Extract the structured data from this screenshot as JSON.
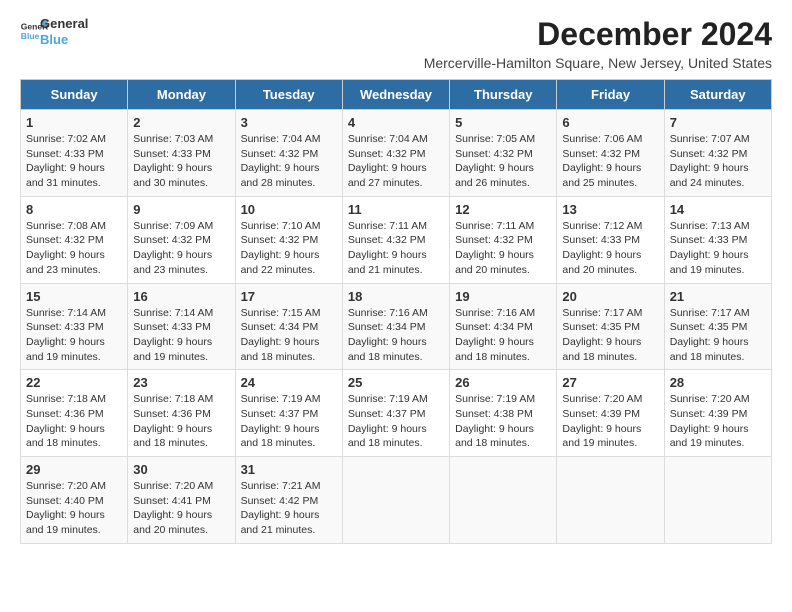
{
  "header": {
    "logo_line1": "General",
    "logo_line2": "Blue",
    "main_title": "December 2024",
    "subtitle": "Mercerville-Hamilton Square, New Jersey, United States"
  },
  "days_of_week": [
    "Sunday",
    "Monday",
    "Tuesday",
    "Wednesday",
    "Thursday",
    "Friday",
    "Saturday"
  ],
  "weeks": [
    [
      {
        "day": "1",
        "sunrise": "7:02 AM",
        "sunset": "4:33 PM",
        "daylight": "9 hours and 31 minutes."
      },
      {
        "day": "2",
        "sunrise": "7:03 AM",
        "sunset": "4:33 PM",
        "daylight": "9 hours and 30 minutes."
      },
      {
        "day": "3",
        "sunrise": "7:04 AM",
        "sunset": "4:32 PM",
        "daylight": "9 hours and 28 minutes."
      },
      {
        "day": "4",
        "sunrise": "7:04 AM",
        "sunset": "4:32 PM",
        "daylight": "9 hours and 27 minutes."
      },
      {
        "day": "5",
        "sunrise": "7:05 AM",
        "sunset": "4:32 PM",
        "daylight": "9 hours and 26 minutes."
      },
      {
        "day": "6",
        "sunrise": "7:06 AM",
        "sunset": "4:32 PM",
        "daylight": "9 hours and 25 minutes."
      },
      {
        "day": "7",
        "sunrise": "7:07 AM",
        "sunset": "4:32 PM",
        "daylight": "9 hours and 24 minutes."
      }
    ],
    [
      {
        "day": "8",
        "sunrise": "7:08 AM",
        "sunset": "4:32 PM",
        "daylight": "9 hours and 23 minutes."
      },
      {
        "day": "9",
        "sunrise": "7:09 AM",
        "sunset": "4:32 PM",
        "daylight": "9 hours and 23 minutes."
      },
      {
        "day": "10",
        "sunrise": "7:10 AM",
        "sunset": "4:32 PM",
        "daylight": "9 hours and 22 minutes."
      },
      {
        "day": "11",
        "sunrise": "7:11 AM",
        "sunset": "4:32 PM",
        "daylight": "9 hours and 21 minutes."
      },
      {
        "day": "12",
        "sunrise": "7:11 AM",
        "sunset": "4:32 PM",
        "daylight": "9 hours and 20 minutes."
      },
      {
        "day": "13",
        "sunrise": "7:12 AM",
        "sunset": "4:33 PM",
        "daylight": "9 hours and 20 minutes."
      },
      {
        "day": "14",
        "sunrise": "7:13 AM",
        "sunset": "4:33 PM",
        "daylight": "9 hours and 19 minutes."
      }
    ],
    [
      {
        "day": "15",
        "sunrise": "7:14 AM",
        "sunset": "4:33 PM",
        "daylight": "9 hours and 19 minutes."
      },
      {
        "day": "16",
        "sunrise": "7:14 AM",
        "sunset": "4:33 PM",
        "daylight": "9 hours and 19 minutes."
      },
      {
        "day": "17",
        "sunrise": "7:15 AM",
        "sunset": "4:34 PM",
        "daylight": "9 hours and 18 minutes."
      },
      {
        "day": "18",
        "sunrise": "7:16 AM",
        "sunset": "4:34 PM",
        "daylight": "9 hours and 18 minutes."
      },
      {
        "day": "19",
        "sunrise": "7:16 AM",
        "sunset": "4:34 PM",
        "daylight": "9 hours and 18 minutes."
      },
      {
        "day": "20",
        "sunrise": "7:17 AM",
        "sunset": "4:35 PM",
        "daylight": "9 hours and 18 minutes."
      },
      {
        "day": "21",
        "sunrise": "7:17 AM",
        "sunset": "4:35 PM",
        "daylight": "9 hours and 18 minutes."
      }
    ],
    [
      {
        "day": "22",
        "sunrise": "7:18 AM",
        "sunset": "4:36 PM",
        "daylight": "9 hours and 18 minutes."
      },
      {
        "day": "23",
        "sunrise": "7:18 AM",
        "sunset": "4:36 PM",
        "daylight": "9 hours and 18 minutes."
      },
      {
        "day": "24",
        "sunrise": "7:19 AM",
        "sunset": "4:37 PM",
        "daylight": "9 hours and 18 minutes."
      },
      {
        "day": "25",
        "sunrise": "7:19 AM",
        "sunset": "4:37 PM",
        "daylight": "9 hours and 18 minutes."
      },
      {
        "day": "26",
        "sunrise": "7:19 AM",
        "sunset": "4:38 PM",
        "daylight": "9 hours and 18 minutes."
      },
      {
        "day": "27",
        "sunrise": "7:20 AM",
        "sunset": "4:39 PM",
        "daylight": "9 hours and 19 minutes."
      },
      {
        "day": "28",
        "sunrise": "7:20 AM",
        "sunset": "4:39 PM",
        "daylight": "9 hours and 19 minutes."
      }
    ],
    [
      {
        "day": "29",
        "sunrise": "7:20 AM",
        "sunset": "4:40 PM",
        "daylight": "9 hours and 19 minutes."
      },
      {
        "day": "30",
        "sunrise": "7:20 AM",
        "sunset": "4:41 PM",
        "daylight": "9 hours and 20 minutes."
      },
      {
        "day": "31",
        "sunrise": "7:21 AM",
        "sunset": "4:42 PM",
        "daylight": "9 hours and 21 minutes."
      },
      null,
      null,
      null,
      null
    ]
  ],
  "labels": {
    "sunrise": "Sunrise:",
    "sunset": "Sunset:",
    "daylight": "Daylight:"
  }
}
